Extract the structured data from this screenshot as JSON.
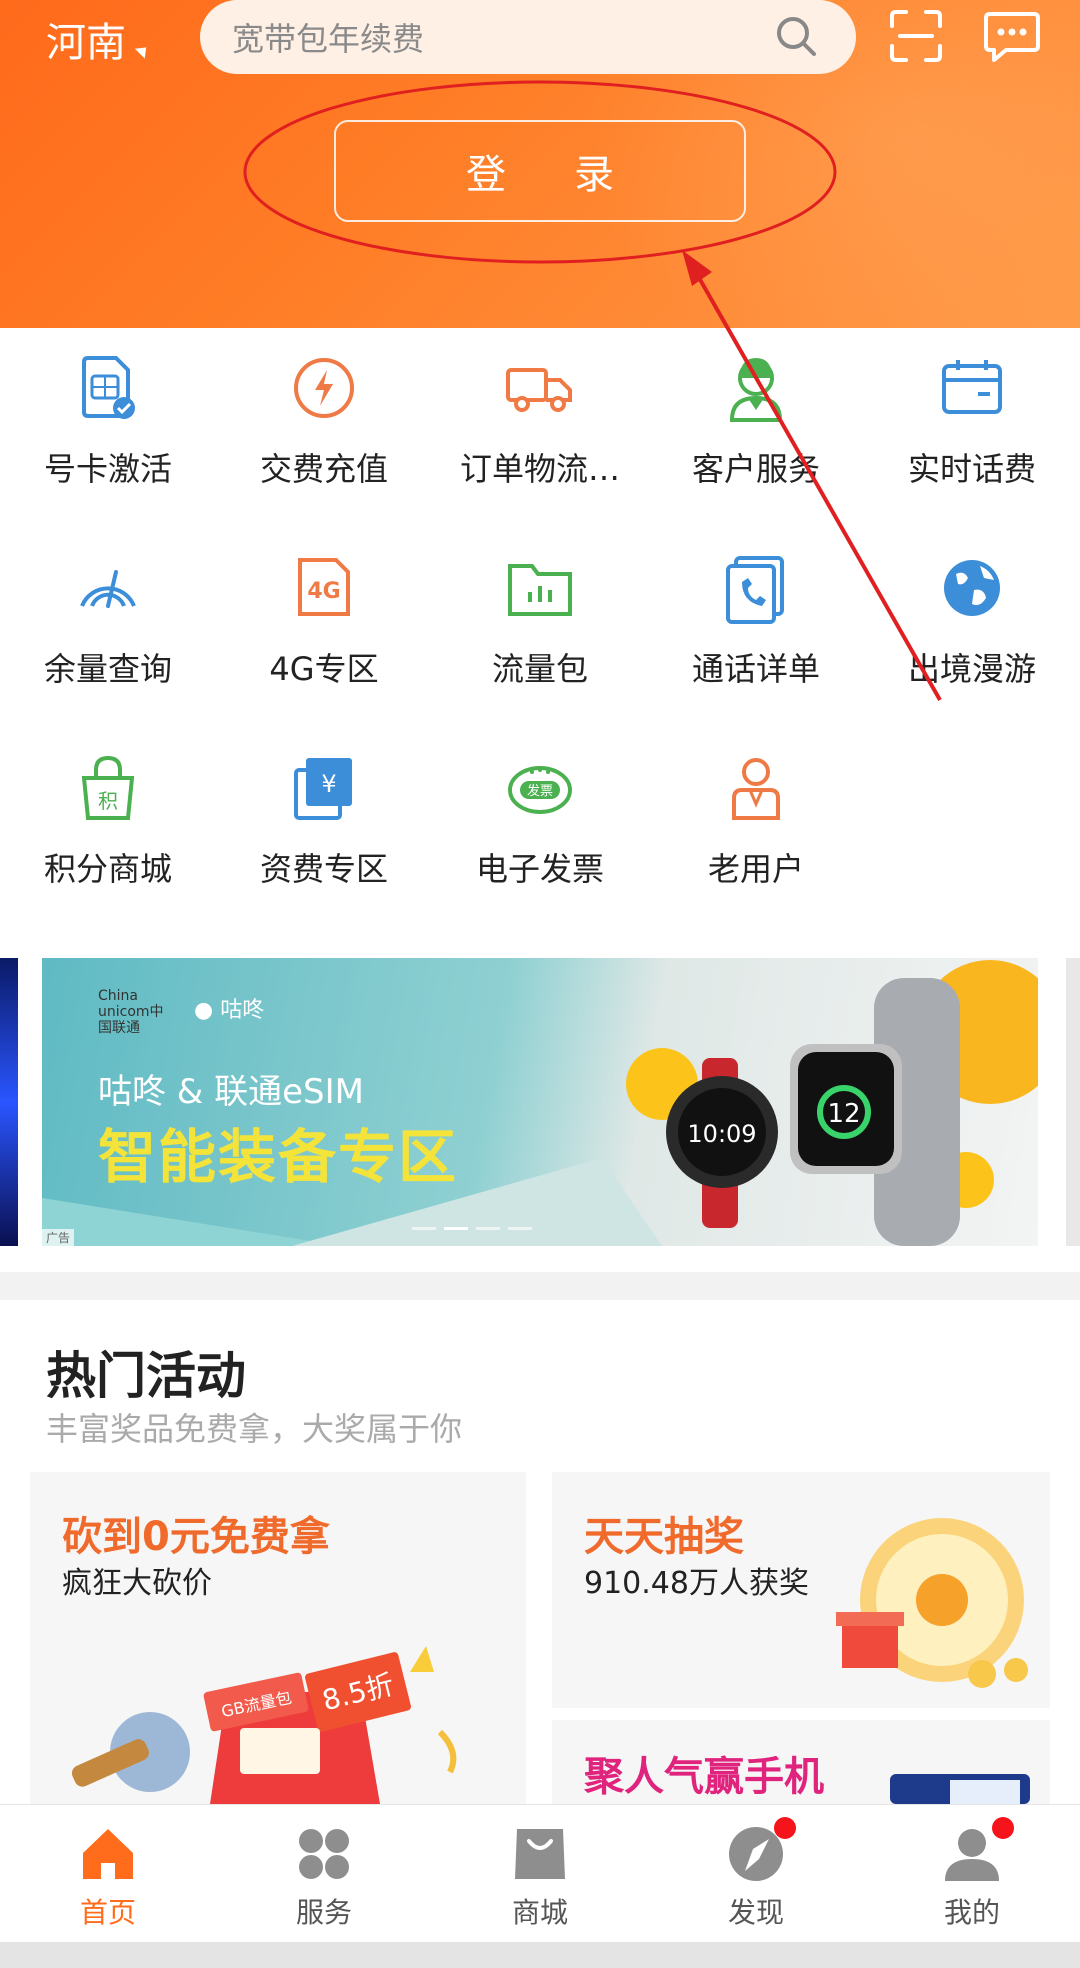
{
  "header": {
    "region": "河南",
    "search_placeholder": "宽带包年续费",
    "login_label": "登录"
  },
  "services": [
    {
      "label": "号卡激活",
      "icon": "sim-card-icon"
    },
    {
      "label": "交费充值",
      "icon": "lightning-icon"
    },
    {
      "label": "订单物流…",
      "icon": "truck-icon"
    },
    {
      "label": "客户服务",
      "icon": "customer-service-icon"
    },
    {
      "label": "实时话费",
      "icon": "calendar-icon"
    },
    {
      "label": "余量查询",
      "icon": "speedometer-icon"
    },
    {
      "label": "4G专区",
      "icon": "4g-icon"
    },
    {
      "label": "流量包",
      "icon": "folder-chart-icon"
    },
    {
      "label": "通话详单",
      "icon": "call-record-icon"
    },
    {
      "label": "出境漫游",
      "icon": "globe-icon"
    },
    {
      "label": "积分商城",
      "icon": "points-bag-icon"
    },
    {
      "label": "资费专区",
      "icon": "yuan-card-icon"
    },
    {
      "label": "电子发票",
      "icon": "invoice-icon"
    },
    {
      "label": "老用户",
      "icon": "user-badge-icon"
    }
  ],
  "banner": {
    "brand": "咕咚",
    "logo_text": "China unicom中国联通",
    "line1": "咕咚 & 联通eSIM",
    "line2": "智能装备专区",
    "ad_tag": "广告",
    "watch1_time": "10:09",
    "watch2_value": "12"
  },
  "hot": {
    "title": "热门活动",
    "subtitle": "丰富奖品免费拿，大奖属于你",
    "cards": [
      {
        "title": "砍到0元免费拿",
        "subtitle": "疯狂大砍价",
        "title_color": "#f06a2c"
      },
      {
        "title": "天天抽奖",
        "subtitle": "910.48万人获奖",
        "title_color": "#f06a2c"
      },
      {
        "title": "聚人气赢手机",
        "subtitle": "",
        "title_color": "#e0237d"
      }
    ],
    "card1_tag1": "GB流量包",
    "card1_tag2": "8.5折"
  },
  "tabbar": [
    {
      "label": "首页",
      "active": true,
      "badge": false,
      "icon": "home-icon"
    },
    {
      "label": "服务",
      "active": false,
      "badge": false,
      "icon": "grid-four-icon"
    },
    {
      "label": "商城",
      "active": false,
      "badge": false,
      "icon": "shopping-bag-icon"
    },
    {
      "label": "发现",
      "active": false,
      "badge": true,
      "icon": "compass-icon"
    },
    {
      "label": "我的",
      "active": false,
      "badge": true,
      "icon": "person-icon"
    }
  ],
  "colors": {
    "brand_orange": "#ff6d1c",
    "annotation_red": "#e02020",
    "badge_red": "#f5141c"
  }
}
